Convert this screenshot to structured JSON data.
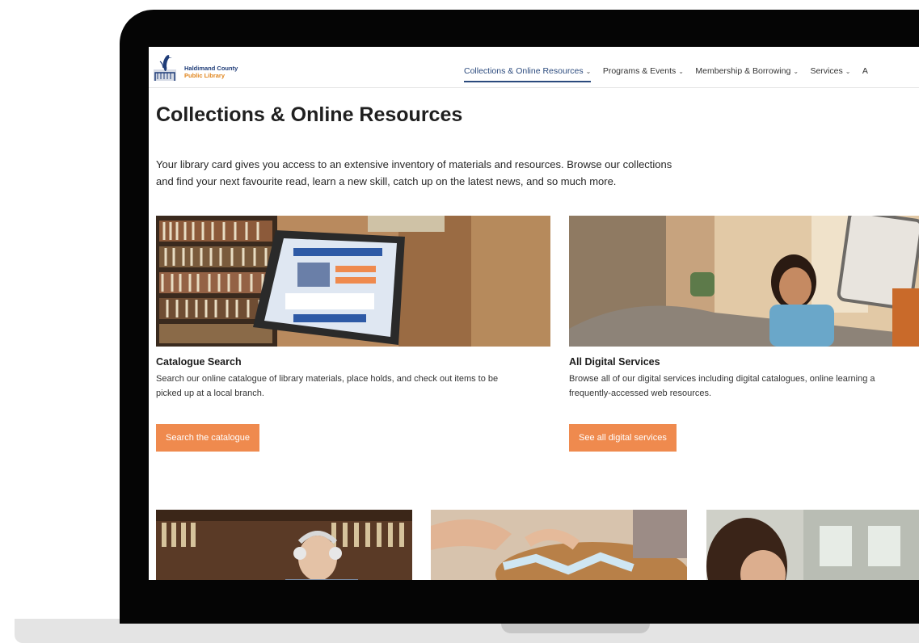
{
  "logo": {
    "line1": "Haldimand County",
    "line2": "Public Library"
  },
  "nav": {
    "items": [
      {
        "label": "Collections & Online Resources"
      },
      {
        "label": "Programs & Events"
      },
      {
        "label": "Membership & Borrowing"
      },
      {
        "label": "Services"
      }
    ],
    "overflow_label": "A"
  },
  "page": {
    "title": "Collections & Online Resources",
    "intro_line1": "Your library card gives you access to an extensive inventory of materials and resources. Browse our collections",
    "intro_line2": "and find your next favourite read, learn a new skill, catch up on the latest news, and so much more."
  },
  "cards": [
    {
      "title": "Catalogue Search",
      "desc_line1": "Search our online catalogue of library materials, place holds, and check out items to be",
      "desc_line2": "picked up at a local branch.",
      "button": "Search the catalogue",
      "image": "library-kiosk-photo"
    },
    {
      "title": "All Digital Services",
      "desc_line1": "Browse all of our digital services including digital catalogues, online learning a",
      "desc_line2": "frequently-accessed web resources.",
      "button": "See all digital services",
      "image": "woman-with-tablet-photo"
    }
  ],
  "bottom_images": [
    "man-with-headphones-photo",
    "puzzle-photo",
    "woman-reading-photo"
  ],
  "colors": {
    "accent_button": "#ef8a4e",
    "nav_active": "#2b4a7d",
    "logo_blue": "#1f3c78",
    "logo_orange": "#e0851d",
    "bezel": "#050505"
  }
}
